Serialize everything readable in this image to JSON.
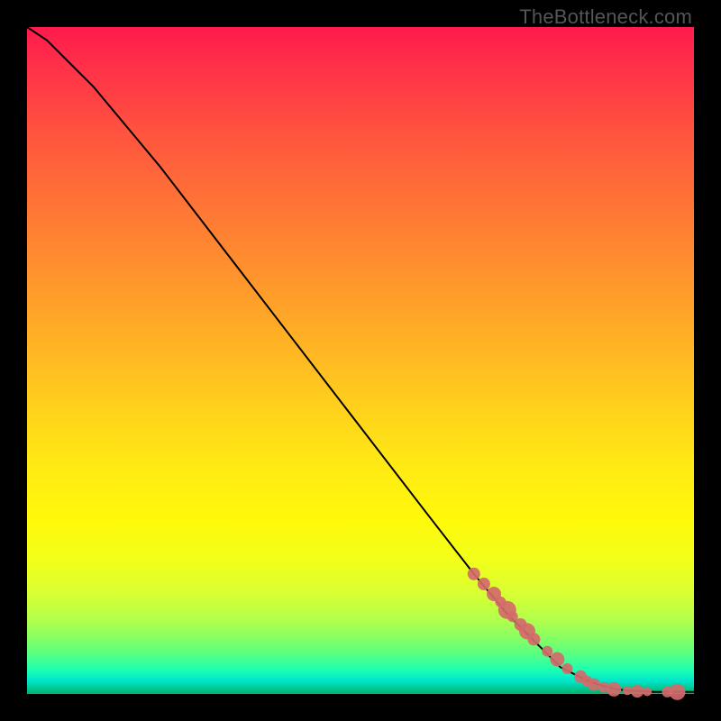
{
  "watermark": "TheBottleneck.com",
  "colors": {
    "dot": "#d46a6a",
    "trace": "#000000",
    "frame_bg": "#000000"
  },
  "chart_data": {
    "type": "line",
    "title": "",
    "xlabel": "",
    "ylabel": "",
    "xlim": [
      0,
      100
    ],
    "ylim": [
      0,
      100
    ],
    "grid": false,
    "legend": false,
    "series": [
      {
        "name": "curve",
        "x": [
          0,
          3,
          6,
          10,
          15,
          20,
          30,
          40,
          50,
          60,
          67,
          72,
          76,
          80,
          82,
          84,
          86,
          88,
          90,
          92,
          94,
          96,
          98,
          100
        ],
        "y": [
          100,
          98,
          95,
          91,
          85,
          79,
          66,
          53,
          40,
          27,
          18,
          12,
          8,
          4,
          3,
          2,
          1.3,
          0.8,
          0.5,
          0.4,
          0.3,
          0.3,
          0.3,
          0.3
        ]
      }
    ],
    "markers": {
      "name": "highlight-dots",
      "x": [
        67,
        68.5,
        70,
        71,
        72,
        72.8,
        74,
        75,
        76,
        78,
        79.5,
        81,
        83,
        84,
        85,
        86.5,
        88,
        90,
        91.5,
        93,
        96,
        97.5
      ],
      "y": [
        18,
        16.5,
        15,
        13.8,
        12.6,
        11.6,
        10.4,
        9.4,
        8.2,
        6.4,
        5.2,
        3.8,
        2.6,
        1.9,
        1.4,
        1.0,
        0.7,
        0.5,
        0.4,
        0.35,
        0.3,
        0.3
      ],
      "r": [
        7,
        7,
        8,
        6,
        10,
        6,
        7,
        9,
        7,
        6,
        8,
        6,
        7,
        6,
        7,
        6,
        8,
        5,
        7,
        5,
        6,
        9
      ]
    }
  }
}
